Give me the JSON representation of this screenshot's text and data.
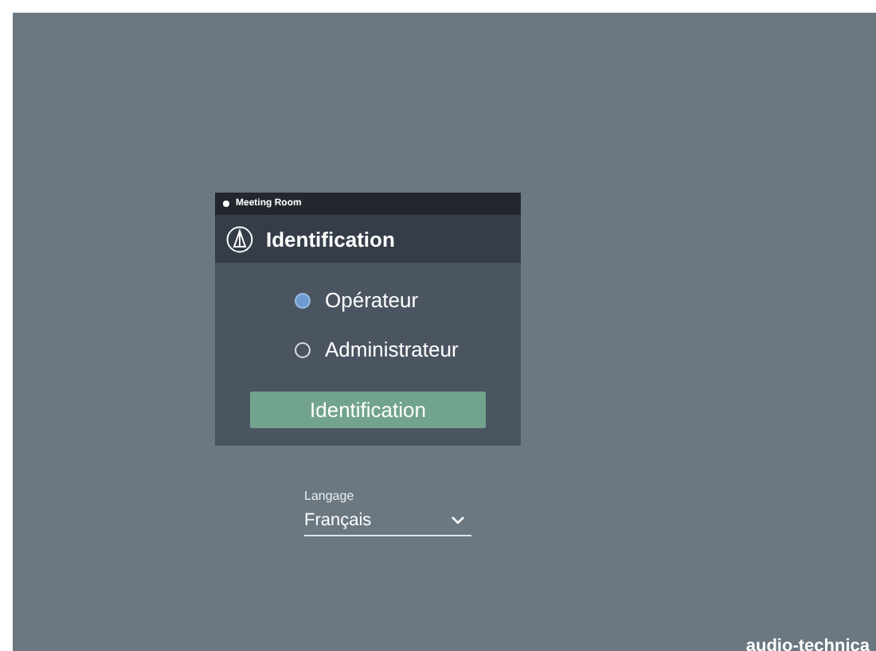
{
  "status_strip": {
    "room": "Meeting Room"
  },
  "dialog": {
    "title": "Identification",
    "roles": [
      {
        "label": "Opérateur",
        "selected": true
      },
      {
        "label": "Administrateur",
        "selected": false
      }
    ],
    "submit": "Identification"
  },
  "language": {
    "label": "Langage",
    "value": "Français"
  },
  "brand": "audio-technica"
}
